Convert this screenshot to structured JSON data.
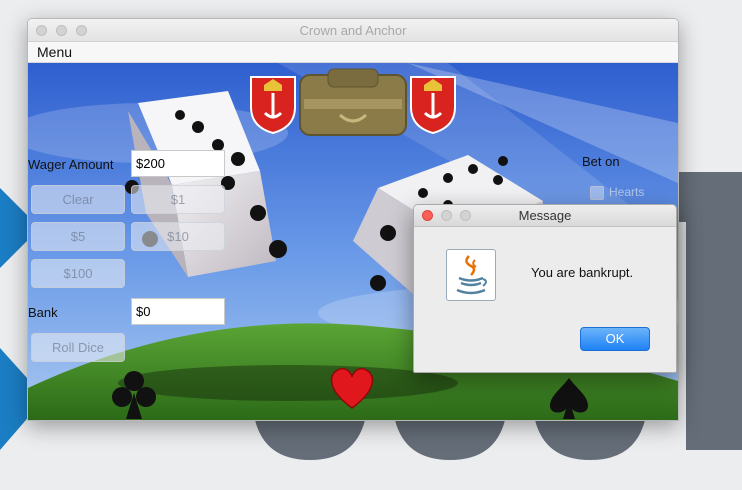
{
  "window": {
    "title": "Crown and Anchor"
  },
  "menubar": {
    "menu_label": "Menu"
  },
  "controls": {
    "wager_label": "Wager Amount",
    "wager_value": "$200",
    "buttons": {
      "clear": "Clear",
      "one": "$1",
      "five": "$5",
      "ten": "$10",
      "hundred": "$100"
    },
    "bank_label": "Bank",
    "bank_value": "$0",
    "roll_label": "Roll Dice"
  },
  "bets": {
    "title": "Bet on",
    "options": [
      "Hearts"
    ]
  },
  "dialog": {
    "title": "Message",
    "message": "You are bankrupt.",
    "ok_label": "OK"
  },
  "colors": {
    "sky": "#3f6fd8",
    "grass": "#3f8a24",
    "ok_blue": "#1f82f6"
  },
  "icons": [
    "java-icon",
    "club-suit-icon",
    "heart-suit-icon",
    "spade-suit-icon",
    "crest-icon",
    "crown-and-anchor-logo"
  ]
}
